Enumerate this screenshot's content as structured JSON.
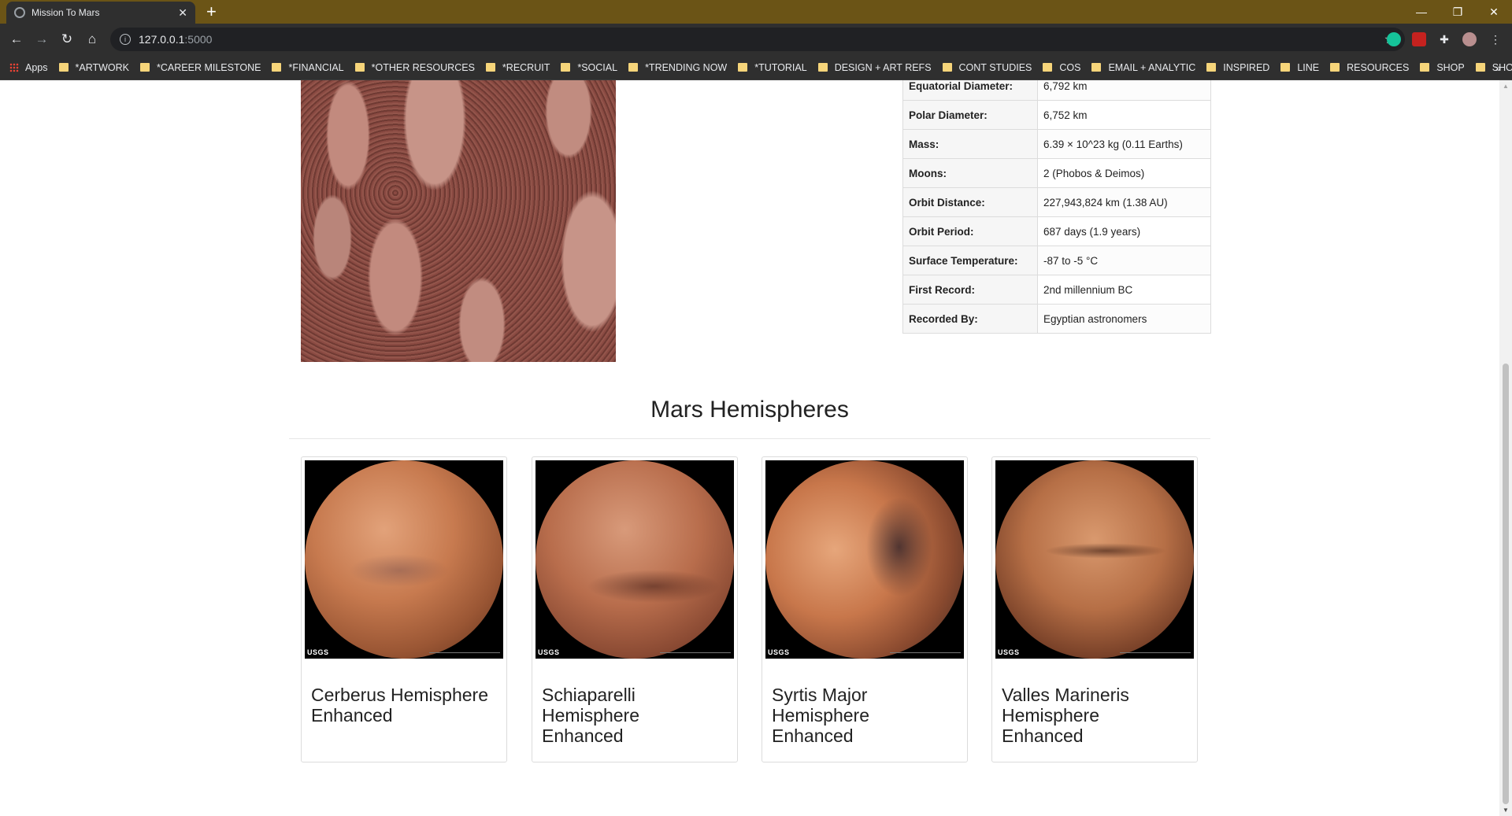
{
  "browser": {
    "tab_title": "Mission To Mars",
    "url_host": "127.0.0.1",
    "url_port": ":5000",
    "bookmarks": [
      "Apps",
      "*ARTWORK",
      "*CAREER MILESTONE",
      "*FINANCIAL",
      "*OTHER RESOURCES",
      "*RECRUIT",
      "*SOCIAL",
      "*TRENDING NOW",
      "*TUTORIAL",
      "DESIGN + ART REFS",
      "CONT STUDIES",
      "COS",
      "EMAIL + ANALYTIC",
      "INSPIRED",
      "LINE",
      "RESOURCES",
      "SHOP",
      "SHOWS"
    ]
  },
  "facts": [
    {
      "label": "Equatorial Diameter:",
      "value": "6,792 km"
    },
    {
      "label": "Polar Diameter:",
      "value": "6,752 km"
    },
    {
      "label": "Mass:",
      "value": "6.39 × 10^23 kg (0.11 Earths)"
    },
    {
      "label": "Moons:",
      "value": "2 (Phobos & Deimos)"
    },
    {
      "label": "Orbit Distance:",
      "value": "227,943,824 km (1.38 AU)"
    },
    {
      "label": "Orbit Period:",
      "value": "687 days (1.9 years)"
    },
    {
      "label": "Surface Temperature:",
      "value": "-87 to -5 °C"
    },
    {
      "label": "First Record:",
      "value": "2nd millennium BC"
    },
    {
      "label": "Recorded By:",
      "value": "Egyptian astronomers"
    }
  ],
  "hemispheres": {
    "title": "Mars Hemispheres",
    "items": [
      {
        "title": "Cerberus Hemisphere Enhanced",
        "logo": "USGS"
      },
      {
        "title": "Schiaparelli Hemisphere Enhanced",
        "logo": "USGS"
      },
      {
        "title": "Syrtis Major Hemisphere Enhanced",
        "logo": "USGS"
      },
      {
        "title": "Valles Marineris Hemisphere Enhanced",
        "logo": "USGS"
      }
    ]
  }
}
